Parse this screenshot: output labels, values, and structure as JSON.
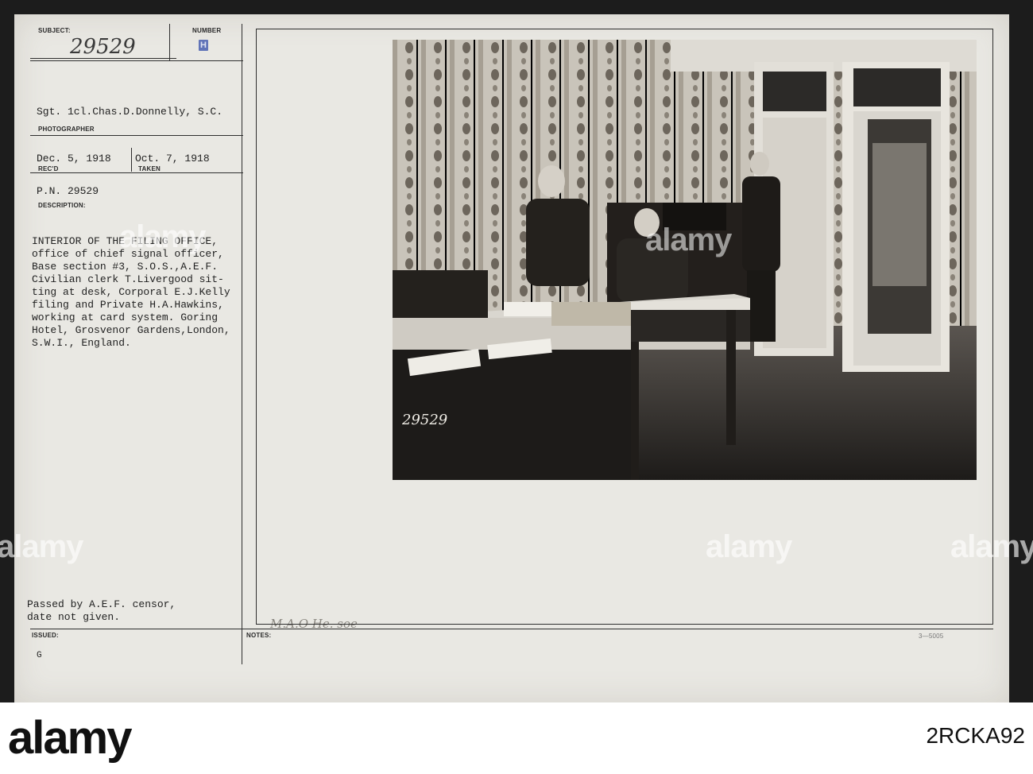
{
  "record": {
    "subject_label": "SUBJECT:",
    "subject_value": "29529",
    "number_label": "NUMBER",
    "number_stamp": "H",
    "photographer_name": "Sgt. 1cl.Chas.D.Donnelly, S.C.",
    "photographer_label": "PHOTOGRAPHER",
    "received_date": "Dec. 5, 1918",
    "received_label": "REC'D",
    "taken_date": "Oct. 7, 1918",
    "taken_label": "TAKEN",
    "pn": "P.N. 29529",
    "description_label": "DESCRIPTION:",
    "description_lines": [
      "INTERIOR OF THE FILING OFFICE,",
      "office of chief signal officer,",
      "Base section #3, S.O.S.,A.E.F.",
      "Civilian clerk T.Livergood sit-",
      "ting at desk, Corporal E.J.Kelly",
      "filing and Private H.A.Hawkins,",
      "working at card system. Goring",
      "Hotel, Grosvenor Gardens,London,",
      "S.W.I., England."
    ],
    "censor_lines": [
      "Passed by A.E.F. censor,",
      "date not given."
    ],
    "issued_label": "ISSUED:",
    "issued_mark": "G",
    "notes_label": "NOTES:",
    "notes_handwriting": "M.A.O He. soe",
    "form_code": "3—5005"
  },
  "photo": {
    "negative_number": "29529"
  },
  "watermark": {
    "text": "alamy"
  },
  "footer": {
    "logo": "alamy",
    "image_id": "2RCKA92"
  }
}
